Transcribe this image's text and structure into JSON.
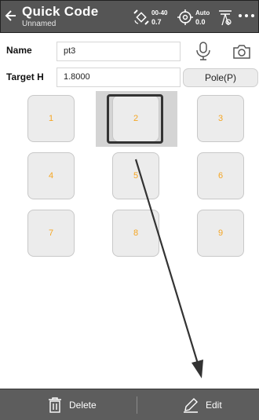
{
  "header": {
    "title": "Quick Code",
    "subtitle": "Unnamed",
    "satellite_top": "00-40",
    "satellite_bottom": "0.7",
    "solution_top": "Auto",
    "solution_bottom": "0.0",
    "icons": [
      "back-arrow",
      "satellite",
      "target",
      "antenna",
      "more"
    ]
  },
  "form": {
    "name_label": "Name",
    "name_value": "pt3",
    "target_h_label": "Target H",
    "target_h_value": "1.8000",
    "pole_button": "Pole(P)"
  },
  "codes": [
    {
      "label": "1"
    },
    {
      "label": "2"
    },
    {
      "label": "3"
    },
    {
      "label": "4"
    },
    {
      "label": "5"
    },
    {
      "label": "6"
    },
    {
      "label": "7"
    },
    {
      "label": "8"
    },
    {
      "label": "9"
    }
  ],
  "selected_code": "2",
  "footer": {
    "delete_label": "Delete",
    "edit_label": "Edit"
  },
  "colors": {
    "toolbar": "#555555",
    "code_text": "#f5a623",
    "button_bg": "#ececec"
  }
}
